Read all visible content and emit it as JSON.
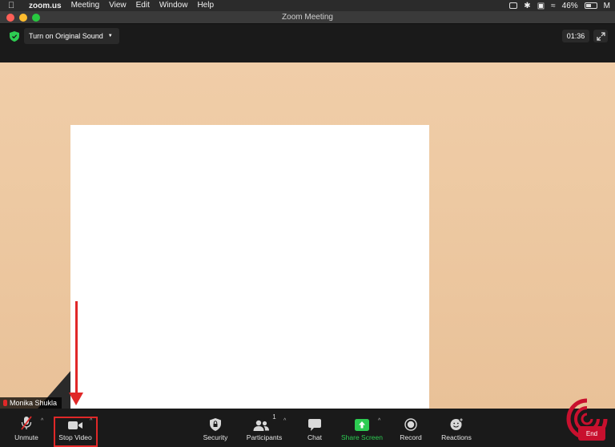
{
  "menubar": {
    "app_name": "zoom.us",
    "items": [
      "Meeting",
      "View",
      "Edit",
      "Window",
      "Help"
    ],
    "battery": "46%",
    "user_initial": "M"
  },
  "window": {
    "title": "Zoom Meeting"
  },
  "topbar": {
    "original_sound_label": "Turn on Original Sound",
    "timer": "01:36"
  },
  "video": {
    "participant_name": "Monika Shukla"
  },
  "toolbar": {
    "unmute": "Unmute",
    "stop_video": "Stop Video",
    "security": "Security",
    "participants": "Participants",
    "participants_count": "1",
    "chat": "Chat",
    "share_screen": "Share Screen",
    "record": "Record",
    "reactions": "Reactions",
    "end": "End"
  },
  "colors": {
    "accent_green": "#2dcc52",
    "alert_red": "#e02828",
    "toolbar_bg": "#1a1a1a"
  }
}
